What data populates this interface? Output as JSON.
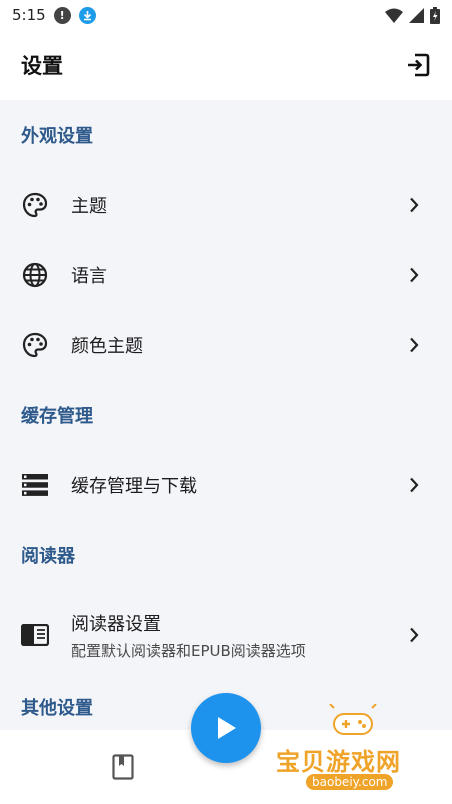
{
  "status_bar": {
    "time": "5:15",
    "icons": [
      "alert-icon",
      "download-icon",
      "wifi-icon",
      "signal-icon",
      "battery-icon"
    ]
  },
  "app_bar": {
    "title": "设置",
    "action_icon": "exit-icon"
  },
  "sections": {
    "appearance": {
      "title": "外观设置",
      "items": [
        {
          "label": "主题",
          "icon": "palette-icon"
        },
        {
          "label": "语言",
          "icon": "globe-icon"
        },
        {
          "label": "颜色主题",
          "icon": "palette-icon"
        }
      ]
    },
    "cache": {
      "title": "缓存管理",
      "items": [
        {
          "label": "缓存管理与下载",
          "icon": "storage-icon"
        }
      ]
    },
    "reader": {
      "title": "阅读器",
      "items": [
        {
          "label": "阅读器设置",
          "sublabel": "配置默认阅读器和EPUB阅读器选项",
          "icon": "reader-icon"
        }
      ]
    },
    "other": {
      "title": "其他设置"
    }
  },
  "bottom_nav": {
    "book_icon": "bookmark-book-icon",
    "fab_icon": "play-icon"
  },
  "watermark": {
    "text": "宝贝游戏网",
    "url": "baobeiy.com"
  },
  "colors": {
    "section_title": "#2f5a8c",
    "fab": "#1e93ee",
    "background": "#f4f5f9",
    "watermark": "#f0a329"
  }
}
